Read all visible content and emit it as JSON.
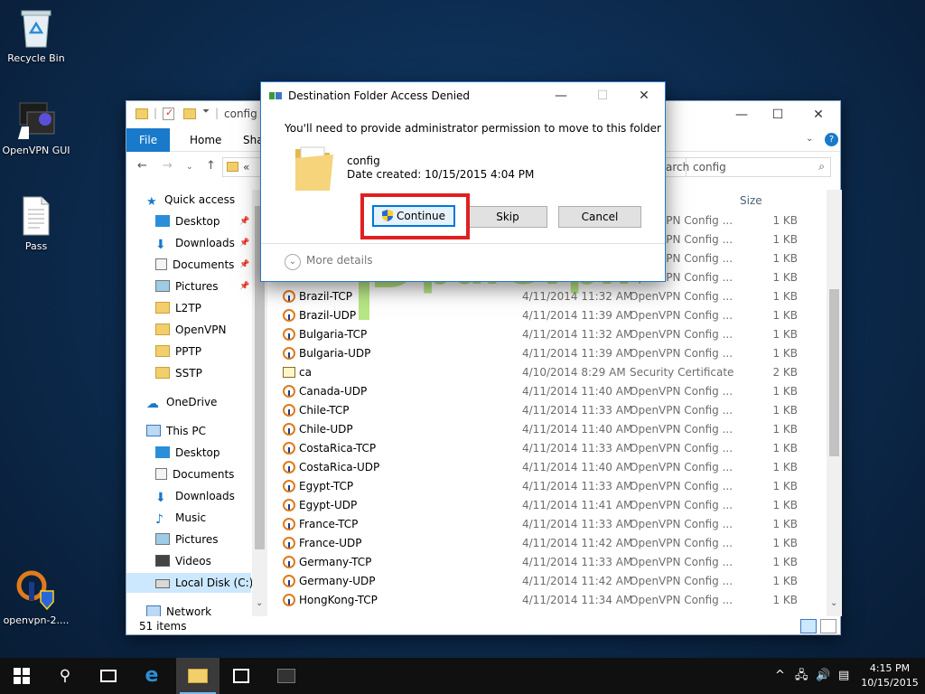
{
  "desktop": {
    "icons": [
      {
        "label": "Recycle Bin"
      },
      {
        "label": "OpenVPN GUI"
      },
      {
        "label": "Pass"
      },
      {
        "label": "openvpn-2...."
      }
    ]
  },
  "explorer": {
    "title": "config",
    "qat_arrow": "⏷",
    "tabs": [
      "File",
      "Home",
      "Sha"
    ],
    "address_text": "«",
    "search_placeholder": "arch config",
    "nav": {
      "quick_access": "Quick access",
      "quick_items": [
        "Desktop",
        "Downloads",
        "Documents",
        "Pictures",
        "L2TP",
        "OpenVPN",
        "PPTP",
        "SSTP"
      ],
      "onedrive": "OneDrive",
      "this_pc": "This PC",
      "pc_items": [
        "Desktop",
        "Documents",
        "Downloads",
        "Music",
        "Pictures",
        "Videos",
        "Local Disk (C:)"
      ],
      "network": "Network"
    },
    "columns": {
      "size": "Size"
    },
    "files": [
      {
        "name": "",
        "date": "",
        "type": "OpenVPN Config ...",
        "size": "1 KB"
      },
      {
        "name": "",
        "date": "",
        "type": "OpenVPN Config ...",
        "size": "1 KB"
      },
      {
        "name": "",
        "date": "",
        "type": "OpenVPN Config ...",
        "size": "1 KB"
      },
      {
        "name": "",
        "date": "",
        "type": "OpenVPN Config ...",
        "size": "1 KB"
      },
      {
        "name": "Brazil-TCP",
        "date": "4/11/2014 11:32 AM",
        "type": "OpenVPN Config ...",
        "size": "1 KB"
      },
      {
        "name": "Brazil-UDP",
        "date": "4/11/2014 11:39 AM",
        "type": "OpenVPN Config ...",
        "size": "1 KB"
      },
      {
        "name": "Bulgaria-TCP",
        "date": "4/11/2014 11:32 AM",
        "type": "OpenVPN Config ...",
        "size": "1 KB"
      },
      {
        "name": "Bulgaria-UDP",
        "date": "4/11/2014 11:39 AM",
        "type": "OpenVPN Config ...",
        "size": "1 KB"
      },
      {
        "name": "ca",
        "date": "4/10/2014 8:29 AM",
        "type": "Security Certificate",
        "size": "2 KB",
        "cert": true
      },
      {
        "name": "Canada-UDP",
        "date": "4/11/2014 11:40 AM",
        "type": "OpenVPN Config ...",
        "size": "1 KB"
      },
      {
        "name": "Chile-TCP",
        "date": "4/11/2014 11:33 AM",
        "type": "OpenVPN Config ...",
        "size": "1 KB"
      },
      {
        "name": "Chile-UDP",
        "date": "4/11/2014 11:40 AM",
        "type": "OpenVPN Config ...",
        "size": "1 KB"
      },
      {
        "name": "CostaRica-TCP",
        "date": "4/11/2014 11:33 AM",
        "type": "OpenVPN Config ...",
        "size": "1 KB"
      },
      {
        "name": "CostaRica-UDP",
        "date": "4/11/2014 11:40 AM",
        "type": "OpenVPN Config ...",
        "size": "1 KB"
      },
      {
        "name": "Egypt-TCP",
        "date": "4/11/2014 11:33 AM",
        "type": "OpenVPN Config ...",
        "size": "1 KB"
      },
      {
        "name": "Egypt-UDP",
        "date": "4/11/2014 11:41 AM",
        "type": "OpenVPN Config ...",
        "size": "1 KB"
      },
      {
        "name": "France-TCP",
        "date": "4/11/2014 11:33 AM",
        "type": "OpenVPN Config ...",
        "size": "1 KB"
      },
      {
        "name": "France-UDP",
        "date": "4/11/2014 11:42 AM",
        "type": "OpenVPN Config ...",
        "size": "1 KB"
      },
      {
        "name": "Germany-TCP",
        "date": "4/11/2014 11:33 AM",
        "type": "OpenVPN Config ...",
        "size": "1 KB"
      },
      {
        "name": "Germany-UDP",
        "date": "4/11/2014 11:42 AM",
        "type": "OpenVPN Config ...",
        "size": "1 KB"
      },
      {
        "name": "HongKong-TCP",
        "date": "4/11/2014 11:34 AM",
        "type": "OpenVPN Config ...",
        "size": "1 KB"
      }
    ],
    "status": "51 items"
  },
  "dialog": {
    "title": "Destination Folder Access Denied",
    "message": "You'll need to provide administrator permission to move to this folder",
    "folder_name": "config",
    "date_created": "Date created: 10/15/2015 4:04 PM",
    "continue_label": "Continue",
    "skip_label": "Skip",
    "cancel_label": "Cancel",
    "more_details": "More details"
  },
  "watermark": {
    "text": "purevpn"
  },
  "taskbar": {
    "time": "4:15 PM",
    "date": "10/15/2015"
  },
  "colors": {
    "accent": "#0078d7",
    "highlight": "#e02020",
    "watermark": "#7ed321"
  }
}
